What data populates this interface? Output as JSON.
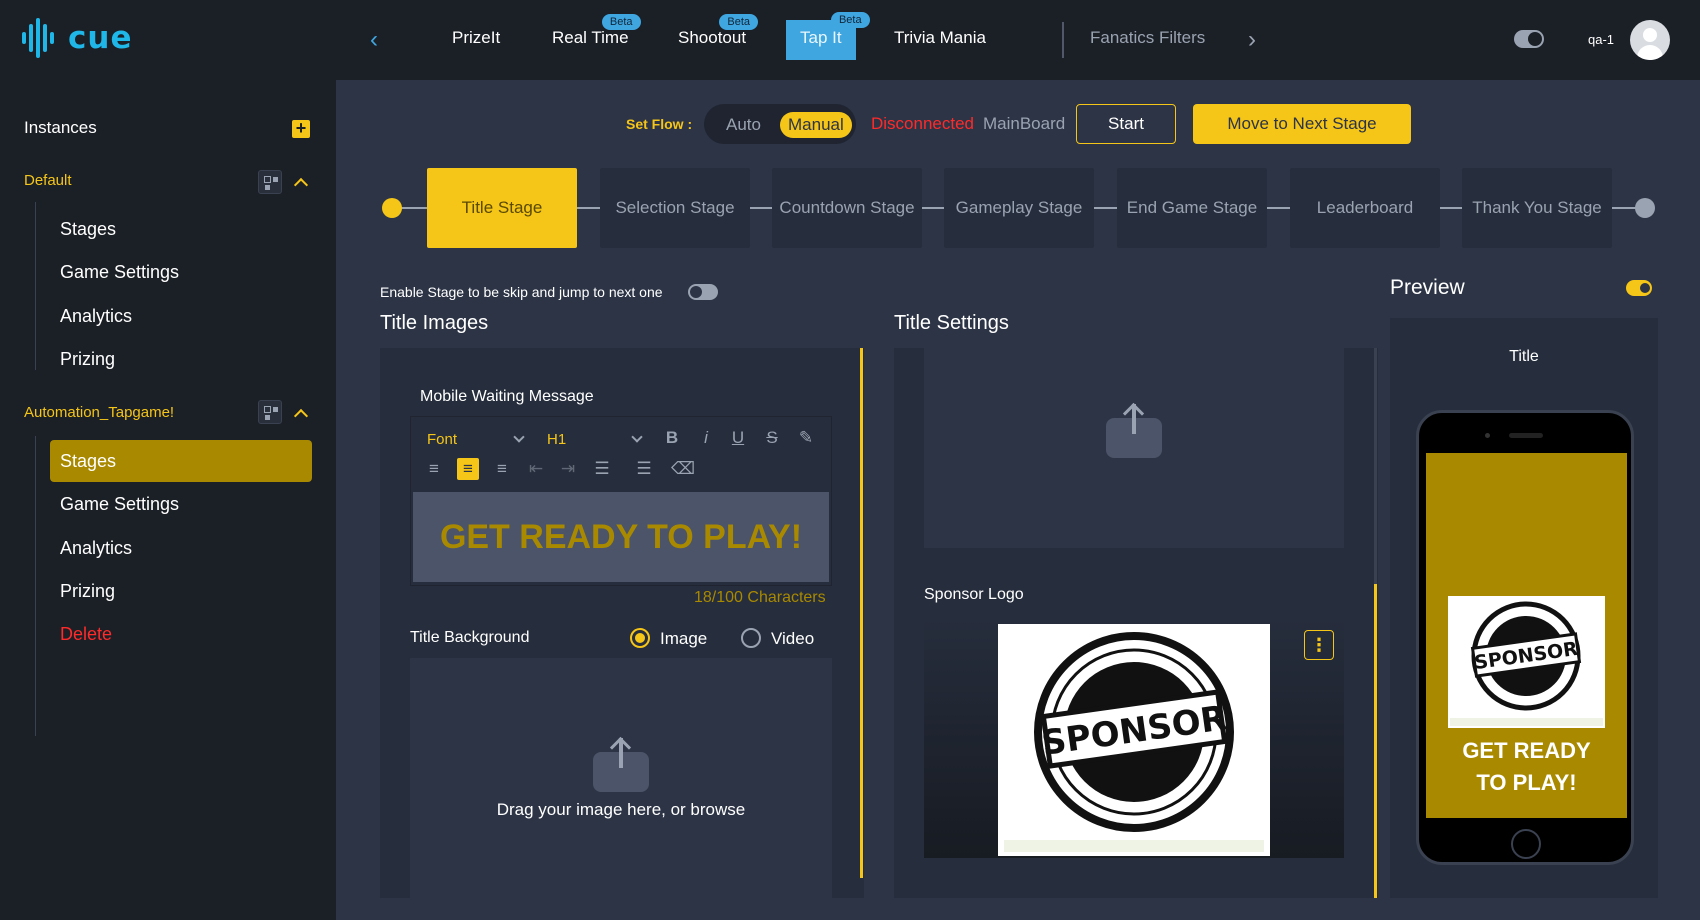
{
  "app": {
    "logo_text": "cue"
  },
  "topnav": {
    "tabs": [
      {
        "label": "PrizeIt",
        "badge": ""
      },
      {
        "label": "Real Time",
        "badge": "Beta"
      },
      {
        "label": "Shootout",
        "badge": "Beta"
      },
      {
        "label": "Tap It",
        "badge": "Beta",
        "active": true
      },
      {
        "label": "Trivia Mania",
        "badge": ""
      },
      {
        "label": "Fanatics Filters",
        "badge": ""
      }
    ],
    "user": "qa-1"
  },
  "sidebar": {
    "heading": "Instances",
    "groups": [
      {
        "name": "Default",
        "items": [
          "Stages",
          "Game Settings",
          "Analytics",
          "Prizing"
        ]
      },
      {
        "name": "Automation_Tapgame!",
        "items": [
          "Stages",
          "Game Settings",
          "Analytics",
          "Prizing",
          "Delete"
        ],
        "active_item": "Stages"
      }
    ]
  },
  "flow": {
    "label": "Set Flow :",
    "options": [
      "Auto",
      "Manual"
    ],
    "selected": "Manual",
    "status_disconnected": "Disconnected",
    "status_board": "MainBoard",
    "start_label": "Start",
    "next_label": "Move to Next Stage"
  },
  "stages": [
    "Title Stage",
    "Selection Stage",
    "Countdown Stage",
    "Gameplay Stage",
    "End Game Stage",
    "Leaderboard",
    "Thank You Stage"
  ],
  "active_stage": "Title Stage",
  "skip_label": "Enable Stage to be skip and jump to next one",
  "title_images": {
    "heading": "Title Images",
    "mobile_message_label": "Mobile Waiting Message",
    "font_placeholder": "Font",
    "heading_select": "H1",
    "message": "GET READY TO PLAY!",
    "char_count": "18/100 Characters",
    "background_label": "Title Background",
    "bg_options": [
      "Image",
      "Video"
    ],
    "bg_selected": "Image",
    "drop_text": "Drag your image here, or browse"
  },
  "title_settings": {
    "heading": "Title Settings",
    "sponsor_label": "Sponsor Logo"
  },
  "preview": {
    "heading": "Preview",
    "phone_label": "Title",
    "phone_message": "GET READY TO PLAY!"
  },
  "colors": {
    "accent": "#f5c518",
    "brand": "#1fb6e8",
    "danger": "#ff2a2a",
    "bg": "#2c3446",
    "panel": "#262d3c"
  }
}
